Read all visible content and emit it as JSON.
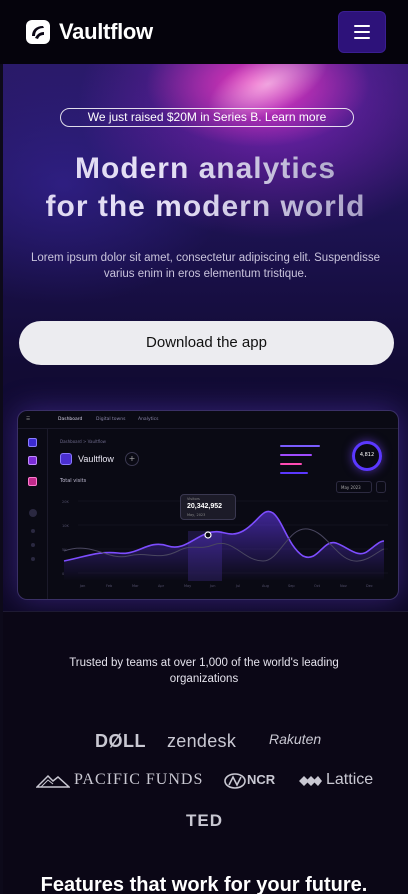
{
  "header": {
    "brand": "Vaultflow",
    "menu_icon": "hamburger-menu-icon",
    "menu_button_color": "#2d127a"
  },
  "hero": {
    "announcement": "We just raised $20M in Series B. Learn more",
    "title_line1": "Modern analytics",
    "title_line2": "for the modern world",
    "subtitle": "Lorem ipsum dolor sit amet, consectetur adipiscing elit. Suspendisse varius enim in eros elementum tristique.",
    "cta": "Download the app"
  },
  "dashboard": {
    "tabs": [
      "Dashboard",
      "Digital towns",
      "Analytics"
    ],
    "breadcrumb": "Dashboard  >  Vaultflow",
    "name": "Vaultflow",
    "total_visits_label": "Total visits",
    "month": "May 2023",
    "ring_value": "4,812",
    "tooltip_label": "Visitors",
    "tooltip_value": "20,342,952",
    "tooltip_date": "May, 2023"
  },
  "trusted": {
    "text": "Trusted by teams at over 1,000 of the world's leading organizations"
  },
  "logos": {
    "dell": "DØLL",
    "zendesk": "zendesk",
    "rakuten": "Rakuten",
    "pacific_funds": "PACIFIC FUNDS",
    "ncr": "NCR",
    "lattice": "Lattice",
    "ted": "TED"
  },
  "features": {
    "heading": "Features that work for your future."
  },
  "colors": {
    "accent": "#5b38ff",
    "hero_glow": "#ff3cbe",
    "background": "#0b0716"
  }
}
